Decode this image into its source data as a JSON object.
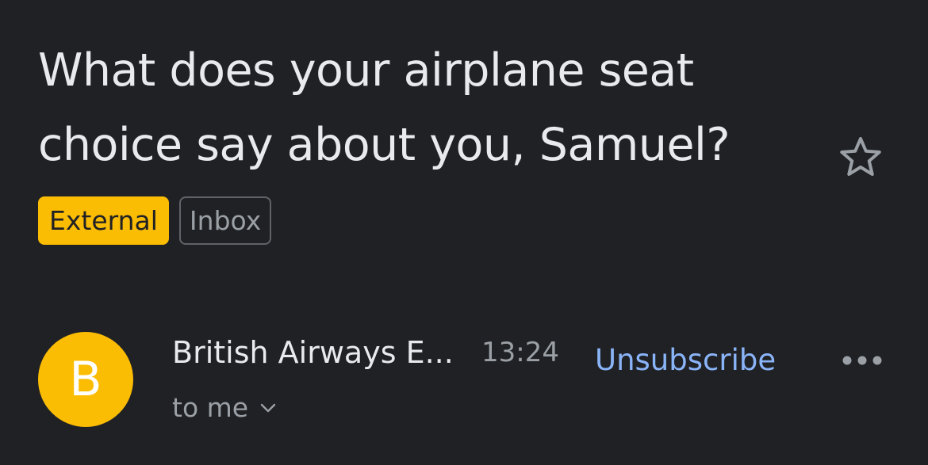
{
  "email": {
    "subject": "What does your airplane seat choice say about you, Samuel?",
    "labels": {
      "external": "External",
      "inbox": "Inbox"
    },
    "sender": {
      "avatar_letter": "B",
      "avatar_color": "#fbbc04",
      "name": "British Airways E...",
      "time": "13:24",
      "recipient": "to me"
    },
    "actions": {
      "unsubscribe": "Unsubscribe"
    },
    "icons": {
      "star": "star-outline-icon",
      "more": "more-horizontal-icon",
      "expand": "chevron-down-icon"
    }
  },
  "colors": {
    "background": "#202124",
    "text_primary": "#e8eaed",
    "text_secondary": "#9aa0a6",
    "link": "#8ab4f8",
    "external_label": "#fbbc04"
  }
}
